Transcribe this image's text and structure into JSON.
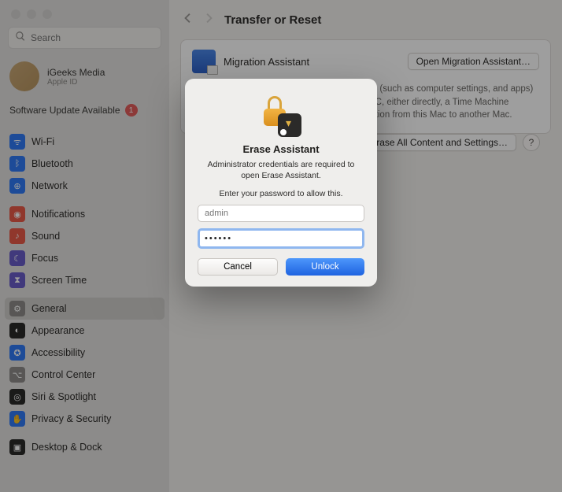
{
  "sidebar": {
    "search_placeholder": "Search",
    "user": {
      "name": "iGeeks Media",
      "sub": "Apple ID"
    },
    "update_label": "Software Update Available",
    "update_count": "1",
    "items": [
      {
        "label": "Wi-Fi"
      },
      {
        "label": "Bluetooth"
      },
      {
        "label": "Network"
      },
      {
        "label": "Notifications"
      },
      {
        "label": "Sound"
      },
      {
        "label": "Focus"
      },
      {
        "label": "Screen Time"
      },
      {
        "label": "General"
      },
      {
        "label": "Appearance"
      },
      {
        "label": "Accessibility"
      },
      {
        "label": "Control Center"
      },
      {
        "label": "Siri & Spotlight"
      },
      {
        "label": "Privacy & Security"
      },
      {
        "label": "Desktop & Dock"
      }
    ]
  },
  "header": {
    "title": "Transfer or Reset"
  },
  "migration": {
    "title": "Migration Assistant",
    "open_btn": "Open Migration Assistant…",
    "description": "Use Migration Assistant to transfer information (such as computer settings, and apps) to this Mac from another Mac or a Windows PC, either directly, a Time Machine backup, or disk. You can also transfer information from this Mac to another Mac.",
    "erase_btn": "Erase All Content and Settings…",
    "help": "?"
  },
  "dialog": {
    "title": "Erase Assistant",
    "message": "Administrator credentials are required to open Erase Assistant.",
    "sub": "Enter your password to allow this.",
    "user_placeholder": "admin",
    "pass_value": "••••••",
    "cancel": "Cancel",
    "unlock": "Unlock"
  }
}
